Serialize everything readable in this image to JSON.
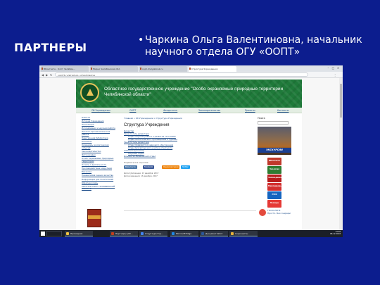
{
  "slide": {
    "title": "ПАРТНЕРЫ",
    "bullet_text": "Чаркина Ольга Валентиновна, начальник научного отдела ОГУ «ООПТ»",
    "background_color": "#0c1d8e"
  },
  "browser": {
    "tabs": [
      {
        "label": "ВКонтакте · Оопт Челябин…"
      },
      {
        "label": "Мирно Челябинская обл."
      },
      {
        "label": "oopt.chelyabinsk.ru"
      },
      {
        "label": "Структура Учреждения",
        "active": true
      }
    ],
    "url": "oopt74.ru/struktura_uchrezhdeniya"
  },
  "site": {
    "banner_title": "Областное государственное учреждение \"Особо охраняемые природные территории Челябинской области\"",
    "menu": [
      "Об Учреждении",
      "ООПТ",
      "Фонды книг",
      "Законодательство",
      "Проекты",
      "Контакты"
    ],
    "sidebar": [
      "Новости",
      "История Учреждения",
      "Экспозиции",
      "Исследования и научная работа",
      "Эколого-просветительская работа",
      "Электронная библиотека",
      "Контакты",
      "Календарь экологических событий",
      "Законодательство",
      "Фото и видео",
      "Особо охраняемые природные территории",
      "Отчеты о деятельности",
      "Противодействие коррупции",
      "Вакансии",
      "Независимая оценка качества",
      "Информация для посетителей",
      "Обратная связь",
      "КРАСНАЯ КНИГА ЧЕЛЯБИНСКОЙ ОБЛАСТИ"
    ],
    "breadcrumbs": "Главная » Об Учреждении » Структура Учреждения",
    "page_title": "Структура Учреждения",
    "structure": [
      {
        "text": "Директор",
        "sub": false
      },
      {
        "text": "Заместитель директора",
        "sub": false
      },
      {
        "text": "Отдел научной работы и развития сети ООПТ",
        "sub": true
      },
      {
        "text": "Отдел экологического просвещения и туризма",
        "sub": true
      },
      {
        "text": "Заместитель директора",
        "sub": false
      },
      {
        "text": "Отдел правового и кадрового обеспечения",
        "sub": true
      },
      {
        "text": "Отдел бухгалтерского учета и отчетности",
        "sub": true
      },
      {
        "text": "Главный бухгалтер",
        "sub": false
      },
      {
        "text": "Научный отдел",
        "sub": true
      },
      {
        "text": "Ильменско-Вишневский отдел",
        "sub": false
      }
    ],
    "share_text": "Поделиться в соцсетях:",
    "share_buttons": [
      {
        "label": "ВКонтакте",
        "color": "#4a76a8"
      },
      {
        "label": "Facebook",
        "color": "#3b5998"
      },
      {
        "label": "Одноклассники",
        "color": "#ee8208"
      },
      {
        "label": "Twitter",
        "color": "#1da1f2"
      }
    ],
    "meta_created": "Дата публикации: 13 декабря, 2017",
    "meta_updated": "Дата изменения: 13 декабря, 2017",
    "right": {
      "heading": "Поиск",
      "promo_label": "ЭКСКУРСИИ",
      "badges": [
        {
          "label": "ВКонтакте",
          "color": "#c0392b"
        },
        {
          "label": "Экология",
          "color": "#2e7d32"
        },
        {
          "label": "Заповедники",
          "color": "#b71c1c"
        },
        {
          "label": "Минприроды",
          "color": "#d32f2f"
        },
        {
          "label": "РФФ",
          "color": "#1565c0"
        },
        {
          "label": "Пожары",
          "color": "#e53935"
        }
      ],
      "gosuslugi_line1": "ГОСУСЛУГИ",
      "gosuslugi_line2": "Просто. Без очереди"
    }
  },
  "taskbar": {
    "items": [
      {
        "label": "Проводник",
        "color": "#f4c542"
      },
      {
        "label": "Партнеры (Сб…",
        "color": "#c43e1c"
      },
      {
        "label": "Структура Учр…",
        "color": "#4285f4"
      },
      {
        "label": "Microsoft Edge",
        "color": "#1e88e5"
      },
      {
        "label": "Документ Word",
        "color": "#2b579a"
      },
      {
        "label": "Скриншоты",
        "color": "#e8b33a"
      }
    ],
    "time": "14:58",
    "date": "06.12.2018"
  }
}
